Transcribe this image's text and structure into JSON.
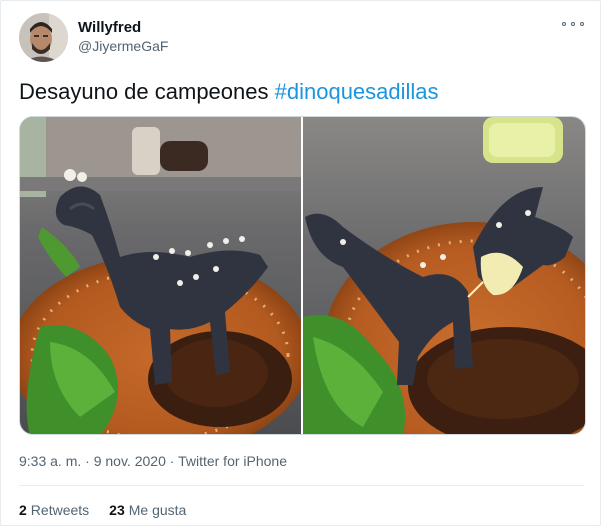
{
  "user": {
    "display_name": "Willyfred",
    "handle": "@JiyermeGaF"
  },
  "tweet": {
    "text": "Desayuno de campeones ",
    "hashtag": "#dinoquesadillas"
  },
  "meta": {
    "time": "9:33 a. m.",
    "separator_1": " · ",
    "date": "9 nov. 2020",
    "separator_2": " · ",
    "source": "Twitter for iPhone"
  },
  "stats": {
    "retweets_count": "2",
    "retweets_label": "Retweets",
    "likes_count": "23",
    "likes_label": "Me gusta"
  },
  "icons": {
    "more": "more-options-icon"
  },
  "colors": {
    "link": "#1b95e0",
    "text": "#0f1419",
    "secondary": "#536471",
    "border": "#e6ecf0"
  }
}
